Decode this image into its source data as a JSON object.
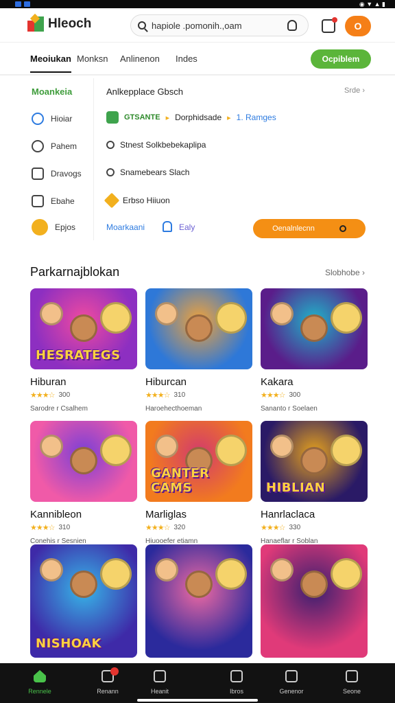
{
  "app": {
    "logo_text": "Hleoch"
  },
  "search": {
    "value": "hapiole .pomonih.,oam",
    "placeholder": ""
  },
  "header": {
    "avatar_letter": "O"
  },
  "tabs": [
    {
      "label": "Meoiukan"
    },
    {
      "label": "Monksn"
    },
    {
      "label": "Anlinenon"
    },
    {
      "label": "Indes"
    }
  ],
  "tabs_cta": "Ocpiblem",
  "sidebar": {
    "title": "Moankeia",
    "items": [
      {
        "label": "Hioiar",
        "icon": "home-icon"
      },
      {
        "label": "Pahem",
        "icon": "help-icon"
      },
      {
        "label": "Dravogs",
        "icon": "chat-icon"
      },
      {
        "label": "Ebahe",
        "icon": "tag-icon"
      },
      {
        "label": "Epjos",
        "icon": "coin-icon"
      }
    ]
  },
  "panel": {
    "title": "Anlkepplace Gbsch",
    "more": "Srde",
    "rows": [
      {
        "badge": "GTSANTE",
        "text": "Dorphidsade",
        "link": "1. Ramges"
      },
      {
        "text": "Stnest  Solkbebekaplipa"
      },
      {
        "text": "Snamebears Slach"
      },
      {
        "text": "Erbso Hiiuon"
      }
    ],
    "link1": "Moarkaani",
    "link2": "Ealy",
    "button": "Oenalnlecnn"
  },
  "section": {
    "title": "Parkarnajblokan",
    "more": "Slobhobe"
  },
  "cards": [
    {
      "title": "Hiburan",
      "rating": "300",
      "meta": "Sarodre r Csalhem",
      "banner": "HESRATEGS",
      "colors": [
        "#8d2fc1",
        "#f04aa0"
      ]
    },
    {
      "title": "Hiburcan",
      "rating": "310",
      "meta": "Haroehecthoeman",
      "banner": "",
      "colors": [
        "#2e78d8",
        "#f0a23a"
      ]
    },
    {
      "title": "Kakara",
      "rating": "300",
      "meta": "Sananto r Soelaen",
      "banner": "",
      "colors": [
        "#5a1d8a",
        "#1fb4c9"
      ]
    },
    {
      "title": "Kannibleon",
      "rating": "310",
      "meta": "Conehis r Sesnien",
      "banner": "",
      "colors": [
        "#f05aa8",
        "#7a3fd6"
      ]
    },
    {
      "title": "Marliglas",
      "rating": "320",
      "meta": "Hiuooefer etiamn",
      "banner": "GANTER CAMS",
      "colors": [
        "#f27b1e",
        "#d23b6d"
      ]
    },
    {
      "title": "Hanrlaclaca",
      "rating": "330",
      "meta": "Hanaeflar r Soblan",
      "banner": "HIBLIAN",
      "colors": [
        "#2a1a66",
        "#e6a21c"
      ]
    },
    {
      "title": "",
      "rating": "",
      "meta": "",
      "banner": "NISHOAK",
      "colors": [
        "#3e2aa8",
        "#37b6e8"
      ]
    },
    {
      "title": "",
      "rating": "",
      "meta": "",
      "banner": "",
      "colors": [
        "#2b2a9c",
        "#f06aa2"
      ]
    },
    {
      "title": "",
      "rating": "",
      "meta": "",
      "banner": "",
      "colors": [
        "#e03a79",
        "#3a1f6f"
      ]
    }
  ],
  "bottom_nav": [
    {
      "label": "Rennele",
      "icon": "home-icon"
    },
    {
      "label": "Renann",
      "icon": "gamepad-icon"
    },
    {
      "label": "Heanit",
      "icon": "clock-icon"
    },
    {
      "label": "Ibros",
      "icon": "bookmark-icon"
    },
    {
      "label": "Genenor",
      "icon": "calendar-icon"
    },
    {
      "label": "Seone",
      "icon": "user-icon"
    }
  ]
}
